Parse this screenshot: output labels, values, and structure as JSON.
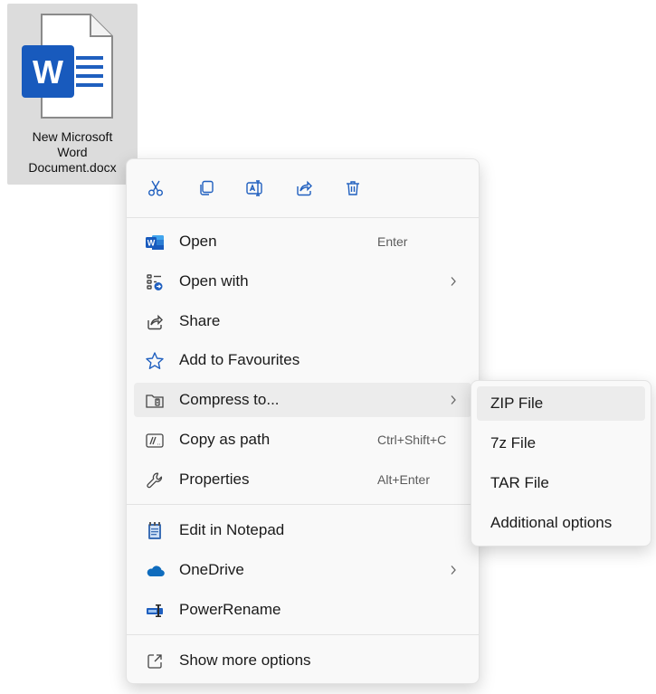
{
  "file": {
    "name_lines": [
      "New Microsoft",
      "Word",
      "Document.docx"
    ],
    "icon": "word-document-icon",
    "accent": "#185abd"
  },
  "quick_actions": [
    {
      "name": "cut-icon"
    },
    {
      "name": "copy-icon"
    },
    {
      "name": "rename-icon"
    },
    {
      "name": "share-icon"
    },
    {
      "name": "delete-icon"
    }
  ],
  "menu": {
    "items": [
      {
        "label": "Open",
        "shortcut": "Enter",
        "icon": "word-app-icon"
      },
      {
        "label": "Open with",
        "shortcut": "",
        "icon": "open-with-icon",
        "submenu": true
      },
      {
        "label": "Share",
        "shortcut": "",
        "icon": "share-icon"
      },
      {
        "label": "Add to Favourites",
        "shortcut": "",
        "icon": "star-icon"
      },
      {
        "label": "Compress to...",
        "shortcut": "",
        "icon": "zip-folder-icon",
        "submenu": true,
        "highlighted": true
      },
      {
        "label": "Copy as path",
        "shortcut": "Ctrl+Shift+C",
        "icon": "copy-path-icon"
      },
      {
        "label": "Properties",
        "shortcut": "Alt+Enter",
        "icon": "wrench-icon"
      },
      {
        "label": "Edit in Notepad",
        "shortcut": "",
        "icon": "notepad-icon"
      },
      {
        "label": "OneDrive",
        "shortcut": "",
        "icon": "onedrive-icon",
        "submenu": true
      },
      {
        "label": "PowerRename",
        "shortcut": "",
        "icon": "powerrename-icon"
      },
      {
        "label": "Show more options",
        "shortcut": "",
        "icon": "show-more-icon"
      }
    ]
  },
  "submenu": {
    "items": [
      {
        "label": "ZIP File",
        "highlighted": true
      },
      {
        "label": "7z File"
      },
      {
        "label": "TAR File"
      },
      {
        "label": "Additional options"
      }
    ]
  },
  "colors": {
    "menu_bg": "#f9f9f9",
    "hover_bg": "#ececec",
    "icon_blue": "#1f5fbf",
    "onedrive_blue": "#0f6cbd"
  }
}
